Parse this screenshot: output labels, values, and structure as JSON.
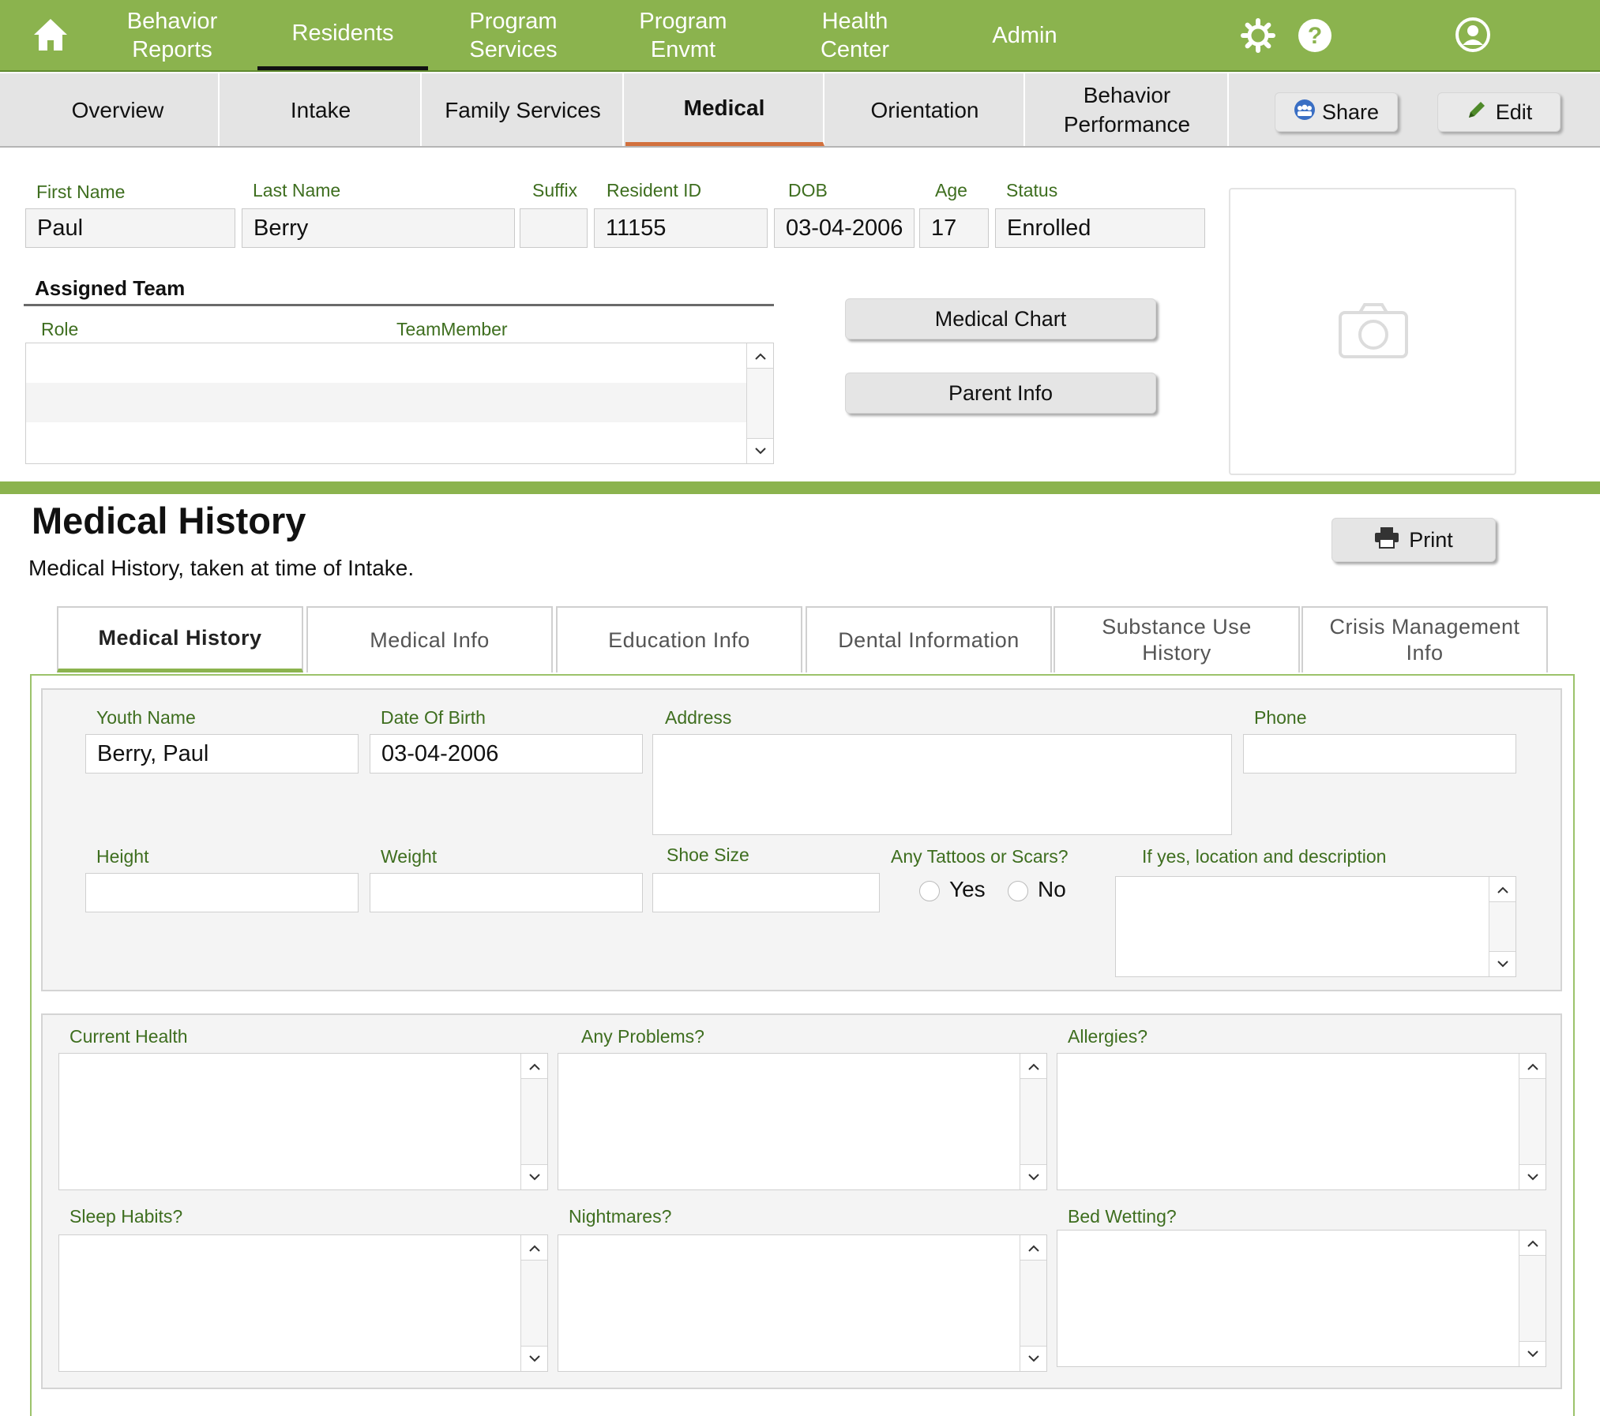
{
  "topnav": {
    "items": [
      {
        "label": "Behavior Reports"
      },
      {
        "label": "Residents"
      },
      {
        "label": "Program Services"
      },
      {
        "label": "Program Envmt"
      },
      {
        "label": "Health Center"
      },
      {
        "label": "Admin"
      }
    ]
  },
  "subnav": {
    "tabs": [
      {
        "label": "Overview"
      },
      {
        "label": "Intake"
      },
      {
        "label": "Family Services"
      },
      {
        "label": "Medical"
      },
      {
        "label": "Orientation"
      },
      {
        "label": "Behavior Performance"
      }
    ],
    "share_label": "Share",
    "edit_label": "Edit"
  },
  "resident": {
    "labels": {
      "first_name": "First Name",
      "last_name": "Last Name",
      "suffix": "Suffix",
      "resident_id": "Resident ID",
      "dob": "DOB",
      "age": "Age",
      "status": "Status"
    },
    "first_name": "Paul",
    "last_name": "Berry",
    "suffix": "",
    "resident_id": "11155",
    "dob": "03-04-2006",
    "age": "17",
    "status": "Enrolled"
  },
  "team": {
    "title": "Assigned Team",
    "col_role": "Role",
    "col_member": "TeamMember"
  },
  "buttons": {
    "medical_chart": "Medical Chart",
    "parent_info": "Parent Info",
    "print": "Print"
  },
  "section": {
    "title": "Medical History",
    "subtitle": "Medical History, taken at time of Intake."
  },
  "form_tabs": [
    {
      "label": "Medical History"
    },
    {
      "label": "Medical Info"
    },
    {
      "label": "Education Info"
    },
    {
      "label": "Dental Information"
    },
    {
      "label": "Substance Use History"
    },
    {
      "label": "Crisis Management Info"
    }
  ],
  "form": {
    "youth_name_label": "Youth Name",
    "youth_name": "Berry, Paul",
    "dob_label": "Date Of Birth",
    "dob": "03-04-2006",
    "address_label": "Address",
    "phone_label": "Phone",
    "height_label": "Height",
    "weight_label": "Weight",
    "shoe_label": "Shoe Size",
    "tattoos_label": "Any Tattoos or Scars?",
    "yes_label": "Yes",
    "no_label": "No",
    "location_label": "If yes, location and description"
  },
  "health": {
    "current_health": "Current Health",
    "problems": "Any Problems?",
    "allergies": "Allergies?",
    "sleep": "Sleep Habits?",
    "nightmares": "Nightmares?",
    "bedwetting": "Bed Wetting?"
  },
  "colors": {
    "brand_green": "#8bb34e",
    "label_green": "#3e6e1f",
    "active_tab_accent": "#d2703d"
  }
}
